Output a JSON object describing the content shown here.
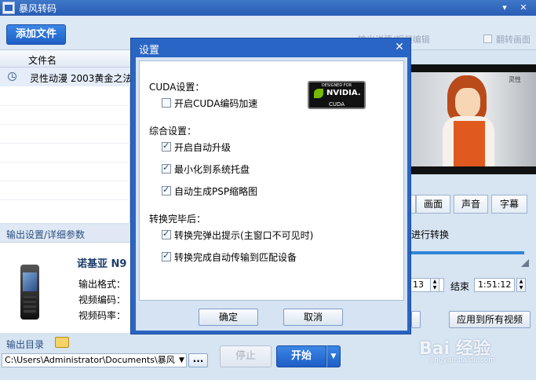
{
  "window": {
    "title": "暴风转码",
    "minimize": "▾",
    "close": "✕"
  },
  "toolbar": {
    "add_file": "添加文件",
    "output_label": "输出详情/视频编辑",
    "flip_label": "翻转画面"
  },
  "filelist": {
    "header": "文件名",
    "rows": [
      {
        "name": "灵性动漫 2003黄金之法"
      }
    ]
  },
  "output": {
    "header": "输出设置/详细参数",
    "device_name": "诺基亚 N9",
    "fields": [
      "输出格式：",
      "视频编码：",
      "视频码率："
    ],
    "dir_label": "输出目录",
    "dir_value": "C:\\Users\\Administrator\\Documents\\暴风",
    "browse": "..."
  },
  "actions": {
    "stop": "停止",
    "start": "开始",
    "start_drop": "▼"
  },
  "preview": {
    "tag": "灵性",
    "tabs": [
      "画面",
      "声音",
      "字幕"
    ],
    "convert_label": "进行转换",
    "start_time": "13",
    "end_label": "结束",
    "end_time": "1:51:12",
    "apply_all": "应用到所有视频"
  },
  "dialog": {
    "title": "设置",
    "close": "✕",
    "cuda_section": "CUDA设置：",
    "cuda_options": [
      {
        "label": "开启CUDA编码加速",
        "checked": false
      }
    ],
    "general_section": "综合设置：",
    "general_options": [
      {
        "label": "开启自动升级",
        "checked": true
      },
      {
        "label": "最小化到系统托盘",
        "checked": true
      },
      {
        "label": "自动生成PSP缩略图",
        "checked": true
      }
    ],
    "after_section": "转换完毕后：",
    "after_options": [
      {
        "label": "转换完弹出提示(主窗口不可见时)",
        "checked": true
      },
      {
        "label": "转换完成自动传输到匹配设备",
        "checked": true
      }
    ],
    "ok": "确定",
    "cancel": "取消",
    "badge": {
      "top": "DESIGNED FOR",
      "brand": "NVIDIA.",
      "bottom": "CUDA"
    }
  },
  "watermark": {
    "main": "Bai 经验",
    "sub": "jingyan.baidu.com"
  }
}
